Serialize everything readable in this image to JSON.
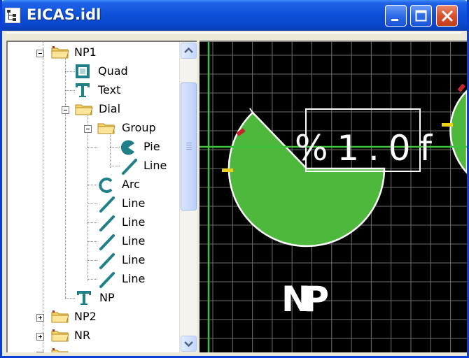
{
  "window": {
    "title": "EICAS.idl",
    "minimize_icon": "minimize-icon",
    "maximize_icon": "maximize-icon",
    "close_icon": "close-icon"
  },
  "tree": {
    "items": [
      {
        "label": "NP1",
        "icon": "folder-icon"
      },
      {
        "label": "Quad",
        "icon": "quad-icon"
      },
      {
        "label": "Text",
        "icon": "text-icon"
      },
      {
        "label": "Dial",
        "icon": "folder-icon"
      },
      {
        "label": "Group",
        "icon": "folder-icon"
      },
      {
        "label": "Pie",
        "icon": "pie-icon"
      },
      {
        "label": "Line",
        "icon": "line-icon"
      },
      {
        "label": "Arc",
        "icon": "arc-icon"
      },
      {
        "label": "Line",
        "icon": "line-icon"
      },
      {
        "label": "Line",
        "icon": "line-icon"
      },
      {
        "label": "Line",
        "icon": "line-icon"
      },
      {
        "label": "Line",
        "icon": "line-icon"
      },
      {
        "label": "Line",
        "icon": "line-icon"
      },
      {
        "label": "NP",
        "icon": "text-icon"
      },
      {
        "label": "NP2",
        "icon": "folder-icon"
      },
      {
        "label": "NR",
        "icon": "folder-icon"
      }
    ]
  },
  "canvas": {
    "format_text": "%1.0f",
    "caption": "NP",
    "colors": {
      "background": "#000000",
      "grid": "#6e6e6e",
      "dial_fill": "#4db83c",
      "crosshair": "#3ec43a",
      "text": "#ffffff",
      "red_tick": "#c0282b",
      "yellow_tick": "#e8d21c"
    }
  }
}
